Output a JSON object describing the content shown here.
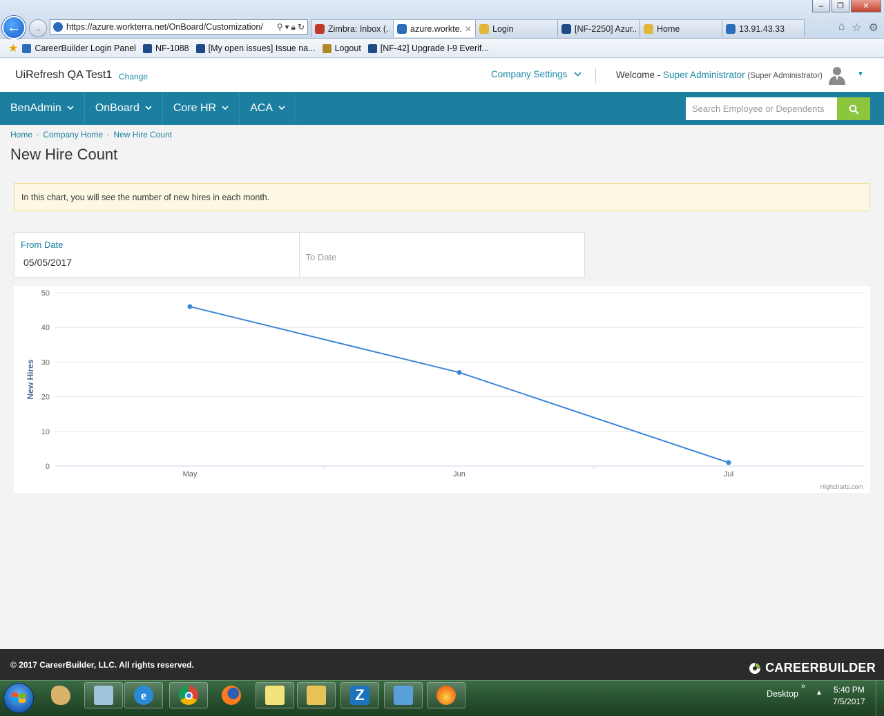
{
  "browser": {
    "address": "https://azure.workterra.net/OnBoard/Customization/",
    "tabs": [
      {
        "label": "Zimbra: Inbox (...",
        "icon": "zimbra-icon",
        "color": "#c0392b",
        "active": false
      },
      {
        "label": "azure.workte...",
        "icon": "ie-page-icon",
        "color": "#2a6db8",
        "active": true
      },
      {
        "label": "Login",
        "icon": "login-icon",
        "color": "#e2b53b",
        "active": false
      },
      {
        "label": "[NF-2250] Azur...",
        "icon": "jira-icon",
        "color": "#1f4a86",
        "active": false
      },
      {
        "label": "Home",
        "icon": "home-page-icon",
        "color": "#e2b53b",
        "active": false
      },
      {
        "label": "13.91.43.33",
        "icon": "ie-page-icon",
        "color": "#2a6db8",
        "active": false
      }
    ],
    "favorites": [
      {
        "label": "CareerBuilder Login Panel",
        "color": "#2a6db8"
      },
      {
        "label": "NF-1088",
        "color": "#1f4a86"
      },
      {
        "label": "[My open issues] Issue na...",
        "color": "#1f4a86"
      },
      {
        "label": "Logout",
        "color": "#b08a2a"
      },
      {
        "label": "[NF-42] Upgrade I-9 Everif...",
        "color": "#1f4a86"
      }
    ]
  },
  "header": {
    "company_name": "UiRefresh QA Test1",
    "change_label": "Change",
    "company_settings_label": "Company Settings",
    "welcome_prefix": "Welcome -",
    "user_name": "Super Administrator",
    "user_role": "(Super Administrator)"
  },
  "nav": {
    "items": [
      {
        "label": "BenAdmin"
      },
      {
        "label": "OnBoard"
      },
      {
        "label": "Core HR"
      },
      {
        "label": "ACA"
      }
    ],
    "search_placeholder": "Search Employee or Dependents"
  },
  "breadcrumb": [
    "Home",
    "Company Home",
    "New Hire Count"
  ],
  "page_title": "New Hire Count",
  "info_text": "In this chart, you will see the number of new hires in each month.",
  "filters": {
    "from_label": "From Date",
    "from_value": "05/05/2017",
    "to_placeholder": "To Date"
  },
  "chart_data": {
    "type": "line",
    "categories": [
      "May",
      "Jun",
      "Jul"
    ],
    "values": [
      46,
      27,
      1
    ],
    "ylabel": "New Hires",
    "ylim": [
      0,
      50
    ],
    "yticks": [
      0,
      10,
      20,
      30,
      40,
      50
    ],
    "grid": true,
    "credit": "Highcharts.com",
    "line_color": "#3b86d6"
  },
  "footer": {
    "copyright": "© 2017 CareerBuilder, LLC. All rights reserved.",
    "logo_text": "CAREERBUILDER"
  },
  "taskbar": {
    "desktop_label": "Desktop",
    "time": "5:40 PM",
    "date": "7/5/2017"
  }
}
